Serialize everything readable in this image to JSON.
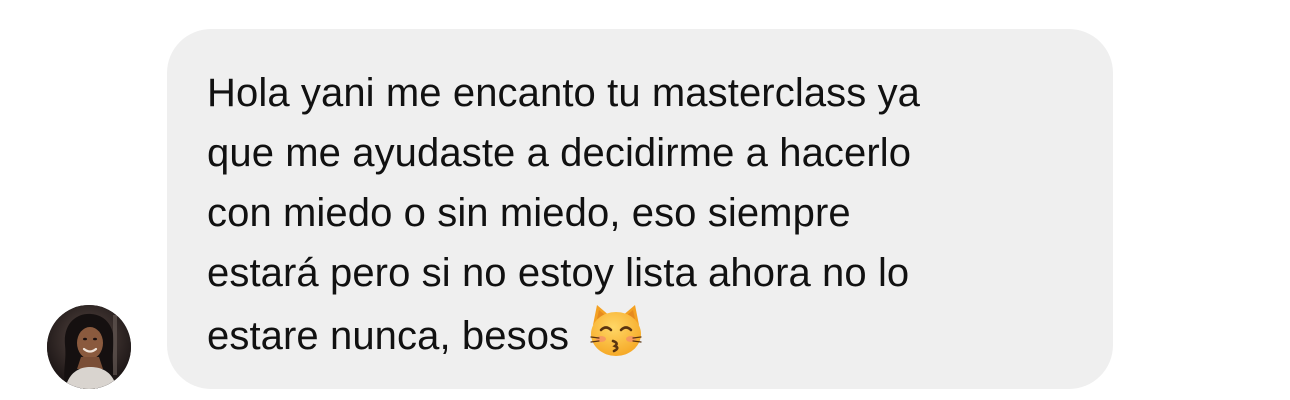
{
  "message": {
    "sender_avatar_icon": "avatar-photo",
    "lines": [
      "Hola yani me encanto tu masterclass ya",
      "que me ayudaste a decidirme a hacerlo",
      "con miedo o sin miedo, eso siempre",
      "estará pero si no estoy lista ahora no lo",
      "estare nunca, besos"
    ],
    "emoji_icon": "kissing-cat-emoji",
    "bubble_color": "#efefef",
    "text_color": "#111111"
  }
}
